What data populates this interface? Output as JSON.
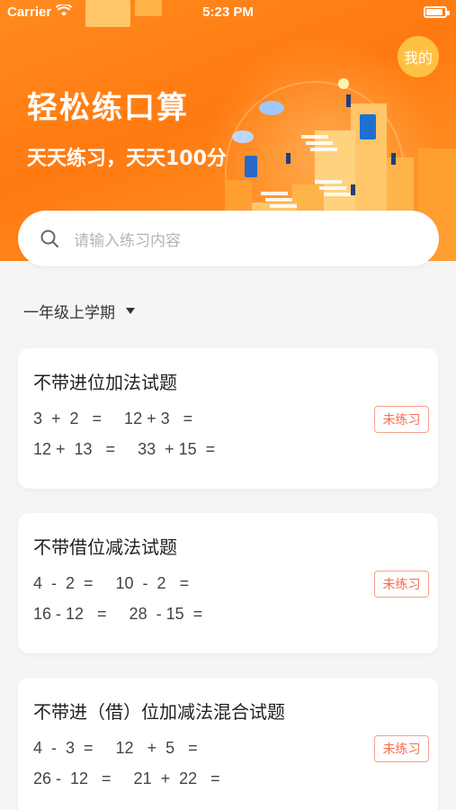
{
  "status_bar": {
    "carrier": "Carrier",
    "time": "5:23 PM"
  },
  "header": {
    "title": "轻松练口算",
    "subtitle": "天天练习，天天100分",
    "mine_label": "我的"
  },
  "search": {
    "placeholder": "请输入练习内容"
  },
  "grade_selector": {
    "label": "一年级上学期"
  },
  "exercises": [
    {
      "title": "不带进位加法试题",
      "lines": [
        "3  +  2   =     12 + 3   =",
        "12 +  13   =     33  + 15  ="
      ],
      "status": "未练习"
    },
    {
      "title": "不带借位减法试题",
      "lines": [
        "4  -  2  =     10  -  2   =",
        "16 - 12   =     28  - 15  ="
      ],
      "status": "未练习"
    },
    {
      "title": "不带进（借）位加减法混合试题",
      "lines": [
        "4  -  3  =     12   +  5   =",
        "26 -  12   =     21  +  22   ="
      ],
      "status": "未练习"
    }
  ],
  "colors": {
    "accent": "#ff7a10",
    "badge": "#f26d4f"
  }
}
